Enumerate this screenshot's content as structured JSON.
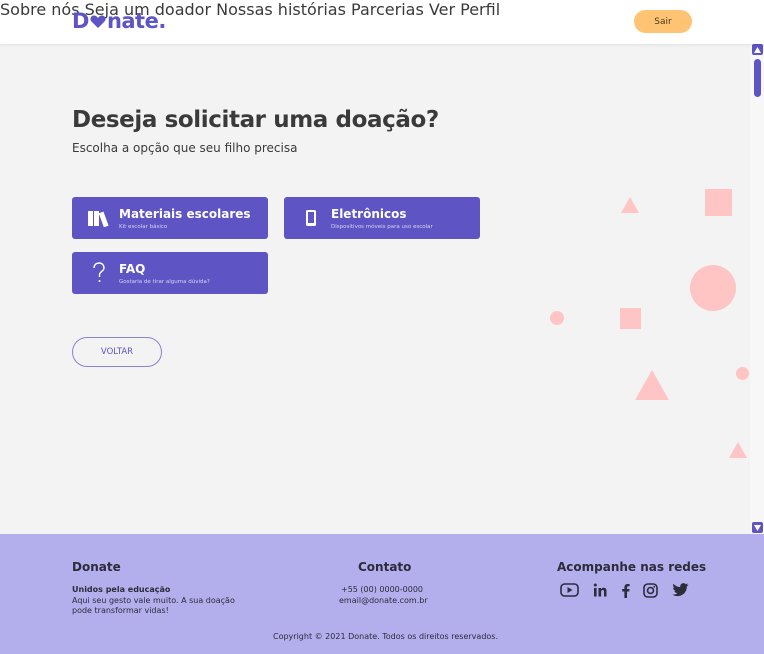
{
  "header": {
    "logo_text_pre": "D",
    "logo_text_post": "nate.",
    "nav": [
      "Sobre nós",
      "Seja um doador",
      "Nossas histórias",
      "Parcerias",
      "Ver Perfil"
    ],
    "logout_label": "Sair"
  },
  "main": {
    "title": "Deseja solicitar uma doação?",
    "subtitle": "Escolha a opção que seu filho precisa",
    "options": [
      {
        "title": "Materiais escolares",
        "subtitle": "Kit escolar básico",
        "icon": "books-icon"
      },
      {
        "title": "Eletrônicos",
        "subtitle": "Dispositivos móveis para uso escolar",
        "icon": "smartphone-icon"
      },
      {
        "title": "FAQ",
        "subtitle": "Gostaria de tirar alguma dúvida?",
        "icon": "question-icon"
      }
    ],
    "back_label": "VOLTAR"
  },
  "footer": {
    "brand": "Donate",
    "tagline": "Unidos pela educação",
    "description_1": "Aqui seu gesto vale muito. A sua doação",
    "description_2": "pode transformar vidas!",
    "contact_title": "Contato",
    "phone": "+55 (00) 0000-0000",
    "email": "email@donate.com.br",
    "social_title": "Acompanhe nas redes",
    "social_icons": [
      "youtube-icon",
      "linkedin-icon",
      "facebook-icon",
      "instagram-icon",
      "twitter-icon"
    ],
    "copyright": "Copyright © 2021 Donate. Todos os direitos reservados."
  },
  "colors": {
    "primary": "#5e54c4",
    "accent": "#ffc473",
    "decor": "#ffc4c4",
    "footer_bg": "#b3aeec"
  }
}
